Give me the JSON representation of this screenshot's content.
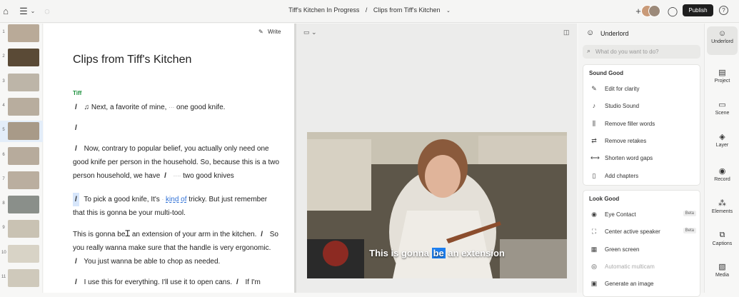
{
  "topbar": {
    "project": "Tiff's Kitchen In Progress",
    "separator": "/",
    "composition": "Clips from Tiff's Kitchen",
    "publish_label": "Publish",
    "plus": "+"
  },
  "thumbnails": [
    {
      "num": "1",
      "color": "#b9aa98"
    },
    {
      "num": "2",
      "color": "#5a4a36"
    },
    {
      "num": "3",
      "color": "#bdb5a8"
    },
    {
      "num": "4",
      "color": "#b8ad9e"
    },
    {
      "num": "5",
      "color": "#a89a88",
      "selected": true
    },
    {
      "num": "6",
      "color": "#b7ab9c"
    },
    {
      "num": "7",
      "color": "#baae9f"
    },
    {
      "num": "8",
      "color": "#8a8f8a"
    },
    {
      "num": "9",
      "color": "#c9c2b3"
    },
    {
      "num": "10",
      "color": "#d8d3c6"
    },
    {
      "num": "11",
      "color": "#cfc9bb"
    }
  ],
  "editor": {
    "write_label": "Write",
    "title": "Clips from Tiff's Kitchen",
    "speaker": "Tiff",
    "p1": {
      "slash": "/",
      "note": "♫",
      "a": "Next, a favorite of mine,",
      "gap": "···",
      "b": "one good knife."
    },
    "p2": {
      "slash": "/"
    },
    "p3": {
      "slash": "/",
      "a": "Now, contrary to popular belief, you actually only need one good knife per person in the household. So, because this is a two person household, we have",
      "slash2": "/",
      "gap": "····",
      "b": "two good knives"
    },
    "p4": {
      "slash": "/",
      "a": "To pick a good knife, It's",
      "gap": "·",
      "ul": "kind of",
      "b": "tricky. But just remember that this is gonna be your multi-tool."
    },
    "p5": {
      "a": "This is gonna be",
      "b": "an extension of your arm in the kitchen.",
      "slash": "/",
      "c": "So you really wanna make sure that the handle is very ergonomic.",
      "slash2": "/",
      "d": "You just wanna be able to chop as needed."
    },
    "p6": {
      "slash": "/",
      "a": "I use this for everything.",
      "b": "I'll use it to open cans.",
      "slash2": "/",
      "c": "If I'm"
    }
  },
  "video": {
    "caption_before": "This is gonna",
    "caption_current": "be",
    "caption_after": "an extension"
  },
  "panel": {
    "title": "Underlord",
    "search_placeholder": "What do you want to do?",
    "sound_title": "Sound Good",
    "sound_items": [
      {
        "icon": "wand-icon",
        "glyph": "✎",
        "label": "Edit for clarity"
      },
      {
        "icon": "mic-icon",
        "glyph": "♪",
        "label": "Studio Sound"
      },
      {
        "icon": "filler-icon",
        "glyph": "⫼",
        "label": "Remove filler words"
      },
      {
        "icon": "retake-icon",
        "glyph": "⇄",
        "label": "Remove retakes"
      },
      {
        "icon": "gap-icon",
        "glyph": "⟷",
        "label": "Shorten word gaps"
      },
      {
        "icon": "bookmark-icon",
        "glyph": "▯",
        "label": "Add chapters"
      }
    ],
    "look_title": "Look Good",
    "look_items": [
      {
        "icon": "eye-icon",
        "glyph": "◉",
        "label": "Eye Contact",
        "beta": "Beta"
      },
      {
        "icon": "speaker-frame-icon",
        "glyph": "⛶",
        "label": "Center active speaker",
        "beta": "Beta"
      },
      {
        "icon": "green-screen-icon",
        "glyph": "▦",
        "label": "Green screen"
      },
      {
        "icon": "multicam-icon",
        "glyph": "◎",
        "label": "Automatic multicam",
        "disabled": true
      },
      {
        "icon": "image-gen-icon",
        "glyph": "▣",
        "label": "Generate an image"
      }
    ]
  },
  "rail": [
    {
      "icon": "underlord-icon",
      "glyph": "☺",
      "label": "Underlord",
      "active": true
    },
    {
      "icon": "project-icon",
      "glyph": "▤",
      "label": "Project"
    },
    {
      "icon": "scene-icon",
      "glyph": "▭",
      "label": "Scene"
    },
    {
      "icon": "layer-icon",
      "glyph": "◈",
      "label": "Layer"
    },
    {
      "icon": "record-icon",
      "glyph": "◉",
      "label": "Record"
    },
    {
      "icon": "elements-icon",
      "glyph": "⁂",
      "label": "Elements"
    },
    {
      "icon": "captions-icon",
      "glyph": "⧉",
      "label": "Captions"
    },
    {
      "icon": "media-icon",
      "glyph": "▧",
      "label": "Media"
    }
  ],
  "colors": {
    "accent": "#1d7ff0",
    "speaker": "#1a8f3a",
    "publish": "#1e1e1e"
  }
}
